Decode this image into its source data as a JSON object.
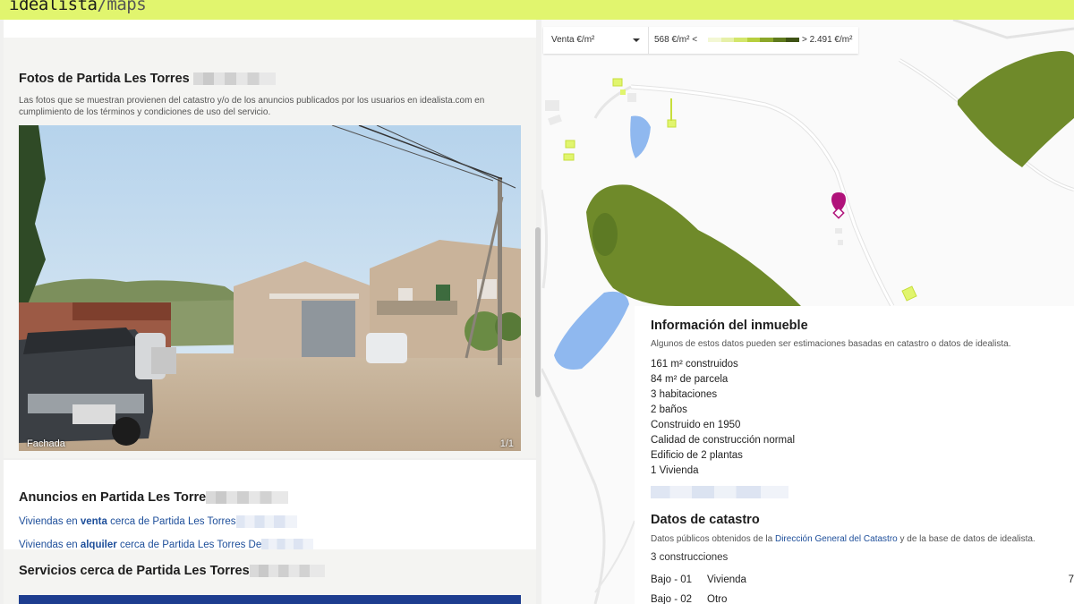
{
  "header": {
    "logo_main": "idealista",
    "logo_sep": "/",
    "logo_sub": "maps"
  },
  "photos": {
    "title": "Fotos de Partida Les Torres",
    "description": "Las fotos que se muestran provienen del catastro y/o de los anuncios publicados por los usuarios en idealista.com en cumplimiento de los términos y condiciones de uso del servicio.",
    "caption": "Fachada",
    "counter": "1/1"
  },
  "anuncios": {
    "title": "Anuncios en Partida Les Torre",
    "venta": {
      "prefix": "Viviendas en ",
      "bold": "venta",
      "suffix": " cerca de Partida Les Torres"
    },
    "alquiler": {
      "prefix": "Viviendas en ",
      "bold": "alquiler",
      "suffix": " cerca de Partida Les Torres De"
    }
  },
  "servicios": {
    "title": "Servicios cerca de Partida Les Torres"
  },
  "legend": {
    "selector": "Venta €/m²",
    "min": "568 €/m² <",
    "max": "> 2.491 €/m²",
    "ramp_colors": [
      "#f3f7d4",
      "#e6f0a8",
      "#d3e66b",
      "#b7cf3e",
      "#8ba629",
      "#5f7a1d",
      "#3e5214"
    ]
  },
  "info": {
    "title": "Información del inmueble",
    "subtitle": "Algunos de estos datos pueden ser estimaciones basadas en catastro o datos de idealista.",
    "features": [
      "161 m² construidos",
      "84 m² de parcela",
      "3 habitaciones",
      "2 baños",
      "Construido en 1950",
      "Calidad de construcción normal",
      "Edificio de 2 plantas",
      "1 Vivienda"
    ]
  },
  "catastro": {
    "title": "Datos de catastro",
    "sub_prefix": "Datos públicos obtenidos de la ",
    "sub_link": "Dirección General del Catastro",
    "sub_suffix": " y de la base de datos de idealista.",
    "constructions": "3 construcciones",
    "rows": [
      {
        "floor": "Bajo - 01",
        "use": "Vivienda",
        "edge": "7"
      },
      {
        "floor": "Bajo - 02",
        "use": "Otro",
        "edge": ""
      }
    ]
  },
  "colors": {
    "header_bg": "#e1f56e",
    "link": "#1d4e9a",
    "marker": "#b0127a",
    "park": "#6f8a2a",
    "water": "#8fb8ef"
  }
}
